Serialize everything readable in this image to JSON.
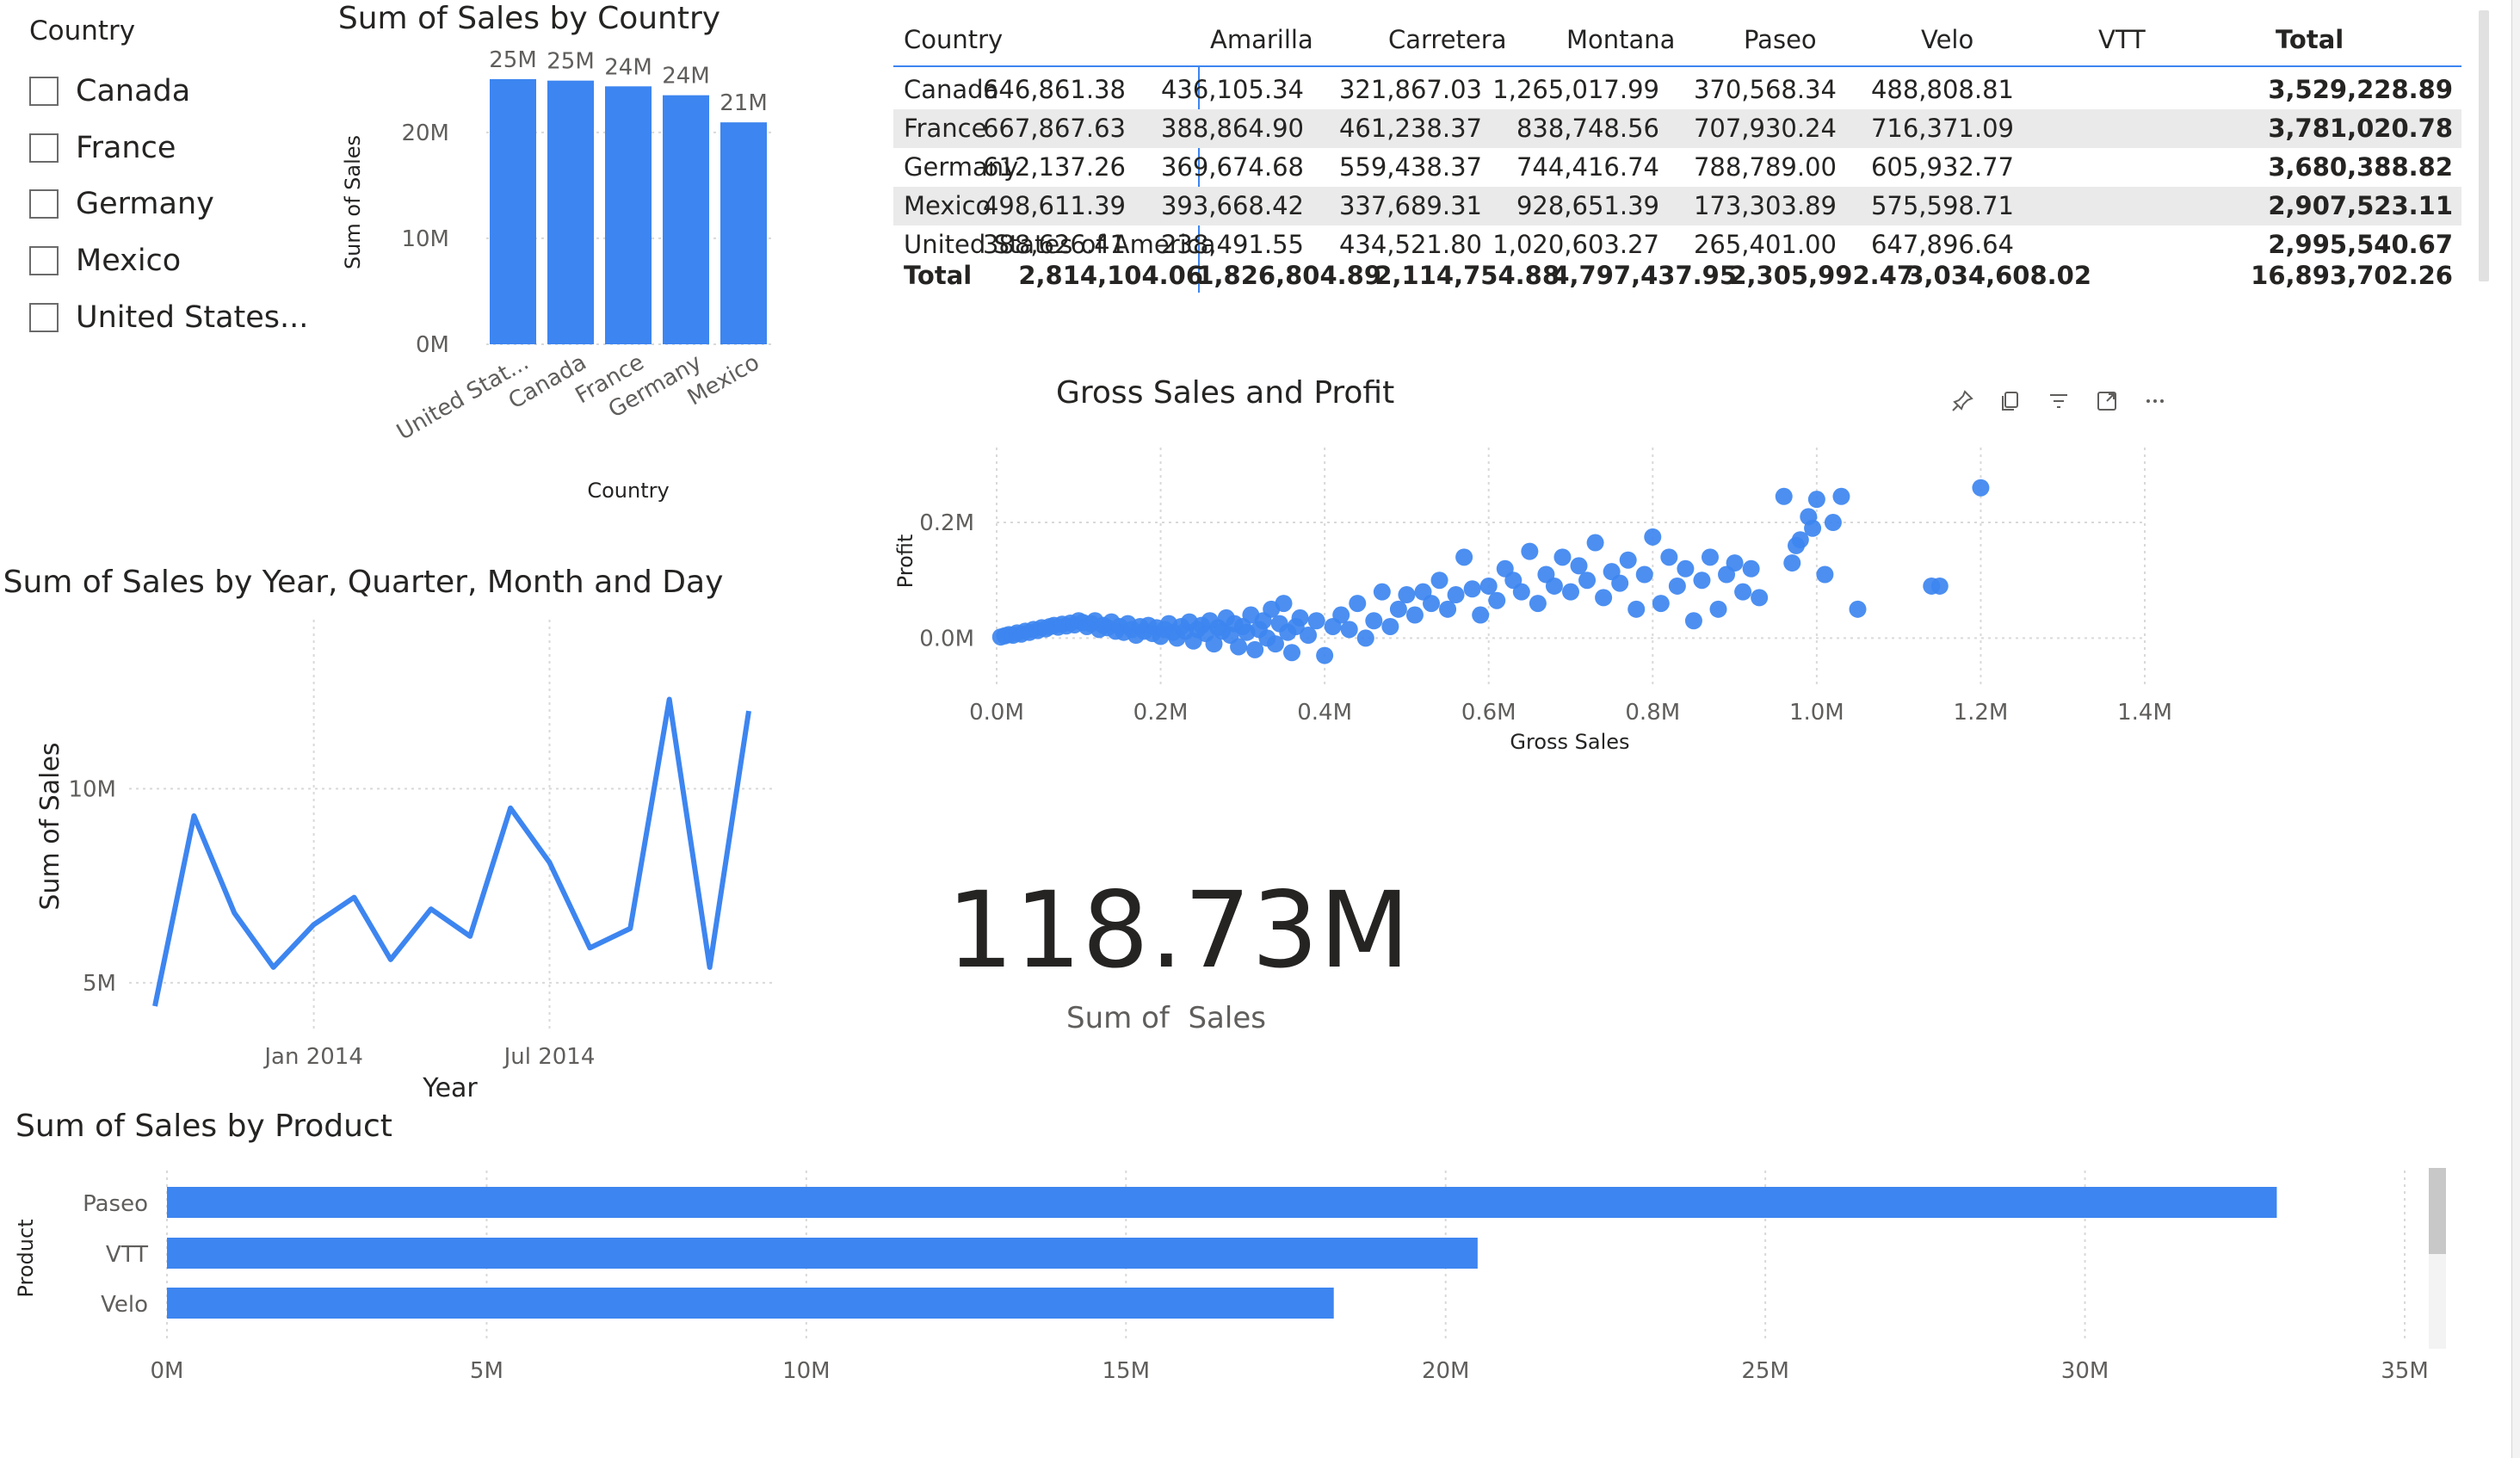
{
  "colors": {
    "accent": "#3d85f0",
    "text": "#252423",
    "muted": "#605e5c",
    "grid": "#d9d9d9",
    "band": "#eaeaea"
  },
  "slicer": {
    "title": "Country",
    "items": [
      {
        "label": "Canada",
        "checked": false
      },
      {
        "label": "France",
        "checked": false
      },
      {
        "label": "Germany",
        "checked": false
      },
      {
        "label": "Mexico",
        "checked": false
      },
      {
        "label": "United States...",
        "checked": false
      }
    ]
  },
  "matrix": {
    "headers": [
      "Country",
      "Amarilla",
      "Carretera",
      "Montana",
      "Paseo",
      "Velo",
      "VTT",
      "Total"
    ],
    "rows": [
      {
        "country": "Canada",
        "values": [
          "646,861.38",
          "436,105.34",
          "321,867.03",
          "1,265,017.99",
          "370,568.34",
          "488,808.81"
        ],
        "total": "3,529,228.89"
      },
      {
        "country": "France",
        "values": [
          "667,867.63",
          "388,864.90",
          "461,238.37",
          "838,748.56",
          "707,930.24",
          "716,371.09"
        ],
        "total": "3,781,020.78"
      },
      {
        "country": "Germany",
        "values": [
          "612,137.26",
          "369,674.68",
          "559,438.37",
          "744,416.74",
          "788,789.00",
          "605,932.77"
        ],
        "total": "3,680,388.82"
      },
      {
        "country": "Mexico",
        "values": [
          "498,611.39",
          "393,668.42",
          "337,689.31",
          "928,651.39",
          "173,303.89",
          "575,598.71"
        ],
        "total": "2,907,523.11"
      },
      {
        "country": "United States of America",
        "values": [
          "388,626.41",
          "238,491.55",
          "434,521.80",
          "1,020,603.27",
          "265,401.00",
          "647,896.64"
        ],
        "total": "2,995,540.67"
      }
    ],
    "total_row": {
      "label": "Total",
      "values": [
        "2,814,104.06",
        "1,826,804.89",
        "2,114,754.88",
        "4,797,437.95",
        "2,305,992.47",
        "3,034,608.02"
      ],
      "total": "16,893,702.26"
    }
  },
  "card": {
    "value": "118.73M",
    "label": "Sum of  Sales"
  },
  "visual_header_icons": [
    "pin-icon",
    "copy-icon",
    "filter-icon",
    "focus-mode-icon",
    "more-options-icon"
  ],
  "chart_data": [
    {
      "id": "country-bar",
      "type": "bar",
      "title": "Sum of Sales by Country",
      "xlabel": "Country",
      "ylabel": "Sum of Sales",
      "categories": [
        "United Stat...",
        "Canada",
        "France",
        "Germany",
        "Mexico"
      ],
      "values": [
        25.03,
        24.89,
        24.35,
        23.51,
        20.95
      ],
      "data_labels": [
        "25M",
        "25M",
        "24M",
        "24M",
        "21M"
      ],
      "ylim": [
        0,
        26
      ],
      "yticks": [
        0,
        10,
        20
      ],
      "ytick_labels": [
        "0M",
        "10M",
        "20M"
      ],
      "grid": true
    },
    {
      "id": "date-line",
      "type": "line",
      "title": "Sum of Sales by Year, Quarter, Month and Day",
      "xlabel": "Year",
      "ylabel": "Sum of Sales",
      "x": [
        "2013-09-01",
        "2013-10-01",
        "2013-11-01",
        "2013-12-01",
        "2014-01-01",
        "2014-02-01",
        "2014-03-01",
        "2014-04-01",
        "2014-05-01",
        "2014-06-01",
        "2014-07-01",
        "2014-08-01",
        "2014-09-01",
        "2014-10-01",
        "2014-11-01",
        "2014-12-01"
      ],
      "y": [
        4.4,
        9.3,
        6.8,
        5.4,
        6.5,
        7.2,
        5.6,
        6.9,
        6.2,
        9.5,
        8.1,
        5.9,
        6.4,
        12.3,
        5.4,
        12.0
      ],
      "ylim": [
        4.2,
        12.8
      ],
      "yticks": [
        5,
        10
      ],
      "ytick_labels": [
        "5M",
        "10M"
      ],
      "xtick_dates": [
        "2014-01-01",
        "2014-07-01"
      ],
      "xtick_labels": [
        "Jan 2014",
        "Jul 2014"
      ],
      "grid": true
    },
    {
      "id": "gross-profit-scatter",
      "type": "scatter",
      "title": "Gross Sales and Profit",
      "xlabel": "Gross Sales",
      "ylabel": "Profit",
      "xlim": [
        0,
        1.4
      ],
      "ylim": [
        -0.05,
        0.27
      ],
      "xticks": [
        0,
        0.2,
        0.4,
        0.6,
        0.8,
        1.0,
        1.2,
        1.4
      ],
      "xtick_labels": [
        "0.0M",
        "0.2M",
        "0.4M",
        "0.6M",
        "0.8M",
        "1.0M",
        "1.2M",
        "1.4M"
      ],
      "yticks": [
        0,
        0.2
      ],
      "ytick_labels": [
        "0.0M",
        "0.2M"
      ],
      "points": [
        [
          0.005,
          0.002
        ],
        [
          0.01,
          0.004
        ],
        [
          0.015,
          0.006
        ],
        [
          0.02,
          0.005
        ],
        [
          0.025,
          0.009
        ],
        [
          0.03,
          0.007
        ],
        [
          0.035,
          0.012
        ],
        [
          0.04,
          0.01
        ],
        [
          0.045,
          0.015
        ],
        [
          0.05,
          0.013
        ],
        [
          0.055,
          0.018
        ],
        [
          0.06,
          0.016
        ],
        [
          0.065,
          0.02
        ],
        [
          0.07,
          0.022
        ],
        [
          0.075,
          0.019
        ],
        [
          0.08,
          0.024
        ],
        [
          0.085,
          0.021
        ],
        [
          0.09,
          0.026
        ],
        [
          0.095,
          0.023
        ],
        [
          0.1,
          0.03
        ],
        [
          0.105,
          0.027
        ],
        [
          0.11,
          0.02
        ],
        [
          0.115,
          0.025
        ],
        [
          0.12,
          0.03
        ],
        [
          0.125,
          0.015
        ],
        [
          0.13,
          0.022
        ],
        [
          0.135,
          0.018
        ],
        [
          0.14,
          0.028
        ],
        [
          0.145,
          0.012
        ],
        [
          0.15,
          0.02
        ],
        [
          0.155,
          0.01
        ],
        [
          0.16,
          0.025
        ],
        [
          0.165,
          0.015
        ],
        [
          0.17,
          0.005
        ],
        [
          0.175,
          0.02
        ],
        [
          0.18,
          0.012
        ],
        [
          0.185,
          0.022
        ],
        [
          0.19,
          0.008
        ],
        [
          0.195,
          0.018
        ],
        [
          0.2,
          0.003
        ],
        [
          0.205,
          0.015
        ],
        [
          0.21,
          0.025
        ],
        [
          0.215,
          0.01
        ],
        [
          0.22,
          0.0
        ],
        [
          0.225,
          0.02
        ],
        [
          0.23,
          0.012
        ],
        [
          0.235,
          0.028
        ],
        [
          0.24,
          -0.005
        ],
        [
          0.245,
          0.015
        ],
        [
          0.25,
          0.022
        ],
        [
          0.255,
          0.008
        ],
        [
          0.26,
          0.03
        ],
        [
          0.265,
          -0.01
        ],
        [
          0.27,
          0.018
        ],
        [
          0.275,
          0.012
        ],
        [
          0.28,
          0.035
        ],
        [
          0.285,
          0.005
        ],
        [
          0.29,
          0.025
        ],
        [
          0.295,
          -0.015
        ],
        [
          0.3,
          0.02
        ],
        [
          0.305,
          0.01
        ],
        [
          0.31,
          0.04
        ],
        [
          0.315,
          -0.02
        ],
        [
          0.32,
          0.015
        ],
        [
          0.325,
          0.03
        ],
        [
          0.33,
          0.0
        ],
        [
          0.335,
          0.05
        ],
        [
          0.34,
          -0.01
        ],
        [
          0.345,
          0.025
        ],
        [
          0.35,
          0.06
        ],
        [
          0.355,
          0.01
        ],
        [
          0.36,
          -0.025
        ],
        [
          0.365,
          0.02
        ],
        [
          0.37,
          0.035
        ],
        [
          0.38,
          0.005
        ],
        [
          0.39,
          0.03
        ],
        [
          0.4,
          -0.03
        ],
        [
          0.41,
          0.02
        ],
        [
          0.42,
          0.04
        ],
        [
          0.43,
          0.015
        ],
        [
          0.44,
          0.06
        ],
        [
          0.45,
          0.0
        ],
        [
          0.46,
          0.03
        ],
        [
          0.47,
          0.08
        ],
        [
          0.48,
          0.02
        ],
        [
          0.49,
          0.05
        ],
        [
          0.5,
          0.075
        ],
        [
          0.51,
          0.04
        ],
        [
          0.52,
          0.08
        ],
        [
          0.53,
          0.06
        ],
        [
          0.54,
          0.1
        ],
        [
          0.55,
          0.05
        ],
        [
          0.56,
          0.075
        ],
        [
          0.57,
          0.14
        ],
        [
          0.58,
          0.085
        ],
        [
          0.59,
          0.04
        ],
        [
          0.6,
          0.09
        ],
        [
          0.61,
          0.065
        ],
        [
          0.62,
          0.12
        ],
        [
          0.63,
          0.1
        ],
        [
          0.64,
          0.08
        ],
        [
          0.65,
          0.15
        ],
        [
          0.66,
          0.06
        ],
        [
          0.67,
          0.11
        ],
        [
          0.68,
          0.09
        ],
        [
          0.69,
          0.14
        ],
        [
          0.7,
          0.08
        ],
        [
          0.71,
          0.125
        ],
        [
          0.72,
          0.1
        ],
        [
          0.73,
          0.165
        ],
        [
          0.74,
          0.07
        ],
        [
          0.75,
          0.115
        ],
        [
          0.76,
          0.095
        ],
        [
          0.77,
          0.135
        ],
        [
          0.78,
          0.05
        ],
        [
          0.79,
          0.11
        ],
        [
          0.8,
          0.175
        ],
        [
          0.81,
          0.06
        ],
        [
          0.82,
          0.14
        ],
        [
          0.83,
          0.09
        ],
        [
          0.84,
          0.12
        ],
        [
          0.85,
          0.03
        ],
        [
          0.86,
          0.1
        ],
        [
          0.87,
          0.14
        ],
        [
          0.88,
          0.05
        ],
        [
          0.89,
          0.11
        ],
        [
          0.9,
          0.13
        ],
        [
          0.91,
          0.08
        ],
        [
          0.92,
          0.12
        ],
        [
          0.93,
          0.07
        ],
        [
          0.96,
          0.245
        ],
        [
          0.97,
          0.13
        ],
        [
          0.98,
          0.17
        ],
        [
          0.99,
          0.21
        ],
        [
          1.0,
          0.24
        ],
        [
          1.01,
          0.11
        ],
        [
          1.02,
          0.2
        ],
        [
          1.03,
          0.245
        ],
        [
          1.05,
          0.05
        ],
        [
          1.15,
          0.09
        ],
        [
          1.2,
          0.26
        ],
        [
          1.14,
          0.09
        ],
        [
          0.995,
          0.19
        ],
        [
          0.975,
          0.16
        ]
      ],
      "grid": true
    },
    {
      "id": "product-bar",
      "type": "bar",
      "orientation": "horizontal",
      "title": "Sum of Sales by Product",
      "ylabel": "Product",
      "categories": [
        "Paseo",
        "VTT",
        "Velo"
      ],
      "values": [
        33.0,
        20.5,
        18.25
      ],
      "xlim": [
        0,
        35
      ],
      "xticks": [
        0,
        5,
        10,
        15,
        20,
        25,
        30,
        35
      ],
      "xtick_labels": [
        "0M",
        "5M",
        "10M",
        "15M",
        "20M",
        "25M",
        "30M",
        "35M"
      ],
      "grid": true
    }
  ]
}
